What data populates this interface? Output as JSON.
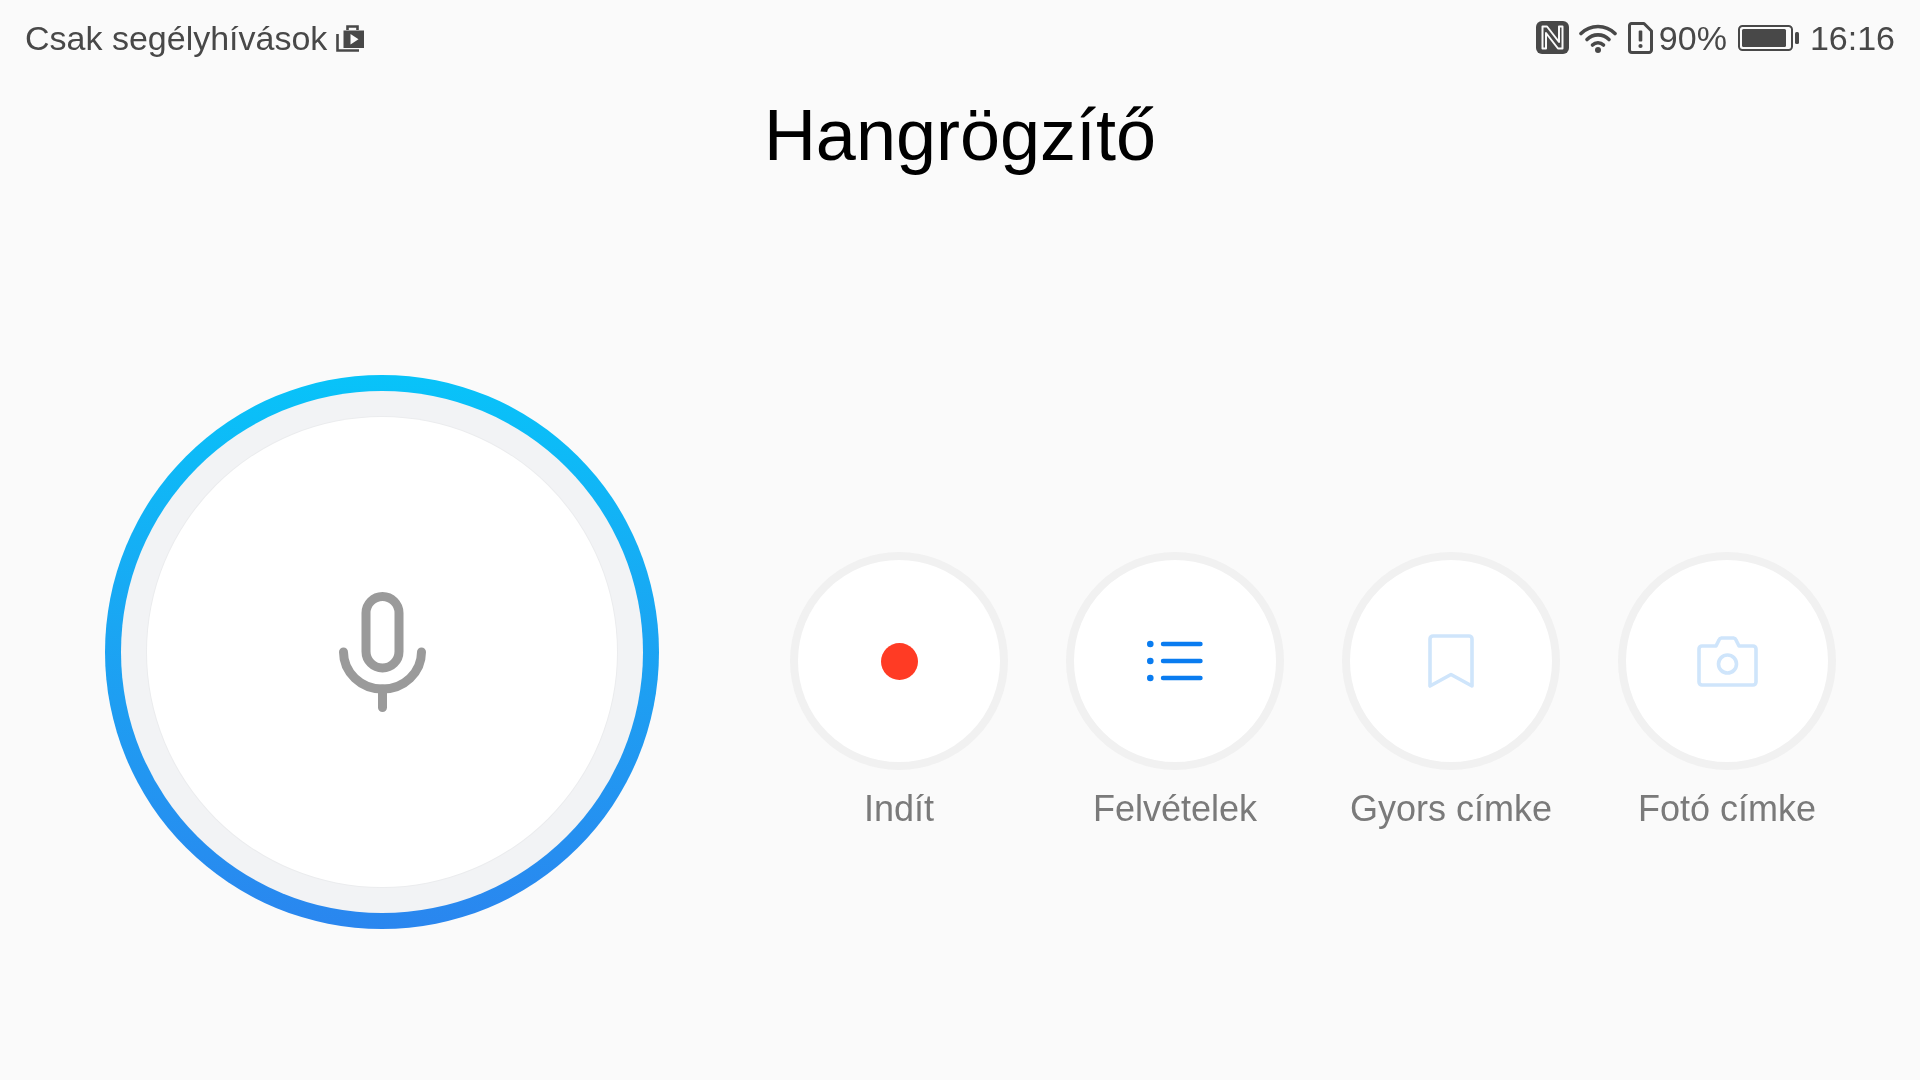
{
  "status_bar": {
    "notice": "Csak segélyhívások",
    "battery_percent": "90%",
    "time": "16:16"
  },
  "title": "Hangrögzítő",
  "actions": [
    {
      "label": "Indít",
      "disabled": false
    },
    {
      "label": "Felvételek",
      "disabled": false
    },
    {
      "label": "Gyors címke",
      "disabled": true
    },
    {
      "label": "Fotó címke",
      "disabled": true
    }
  ]
}
